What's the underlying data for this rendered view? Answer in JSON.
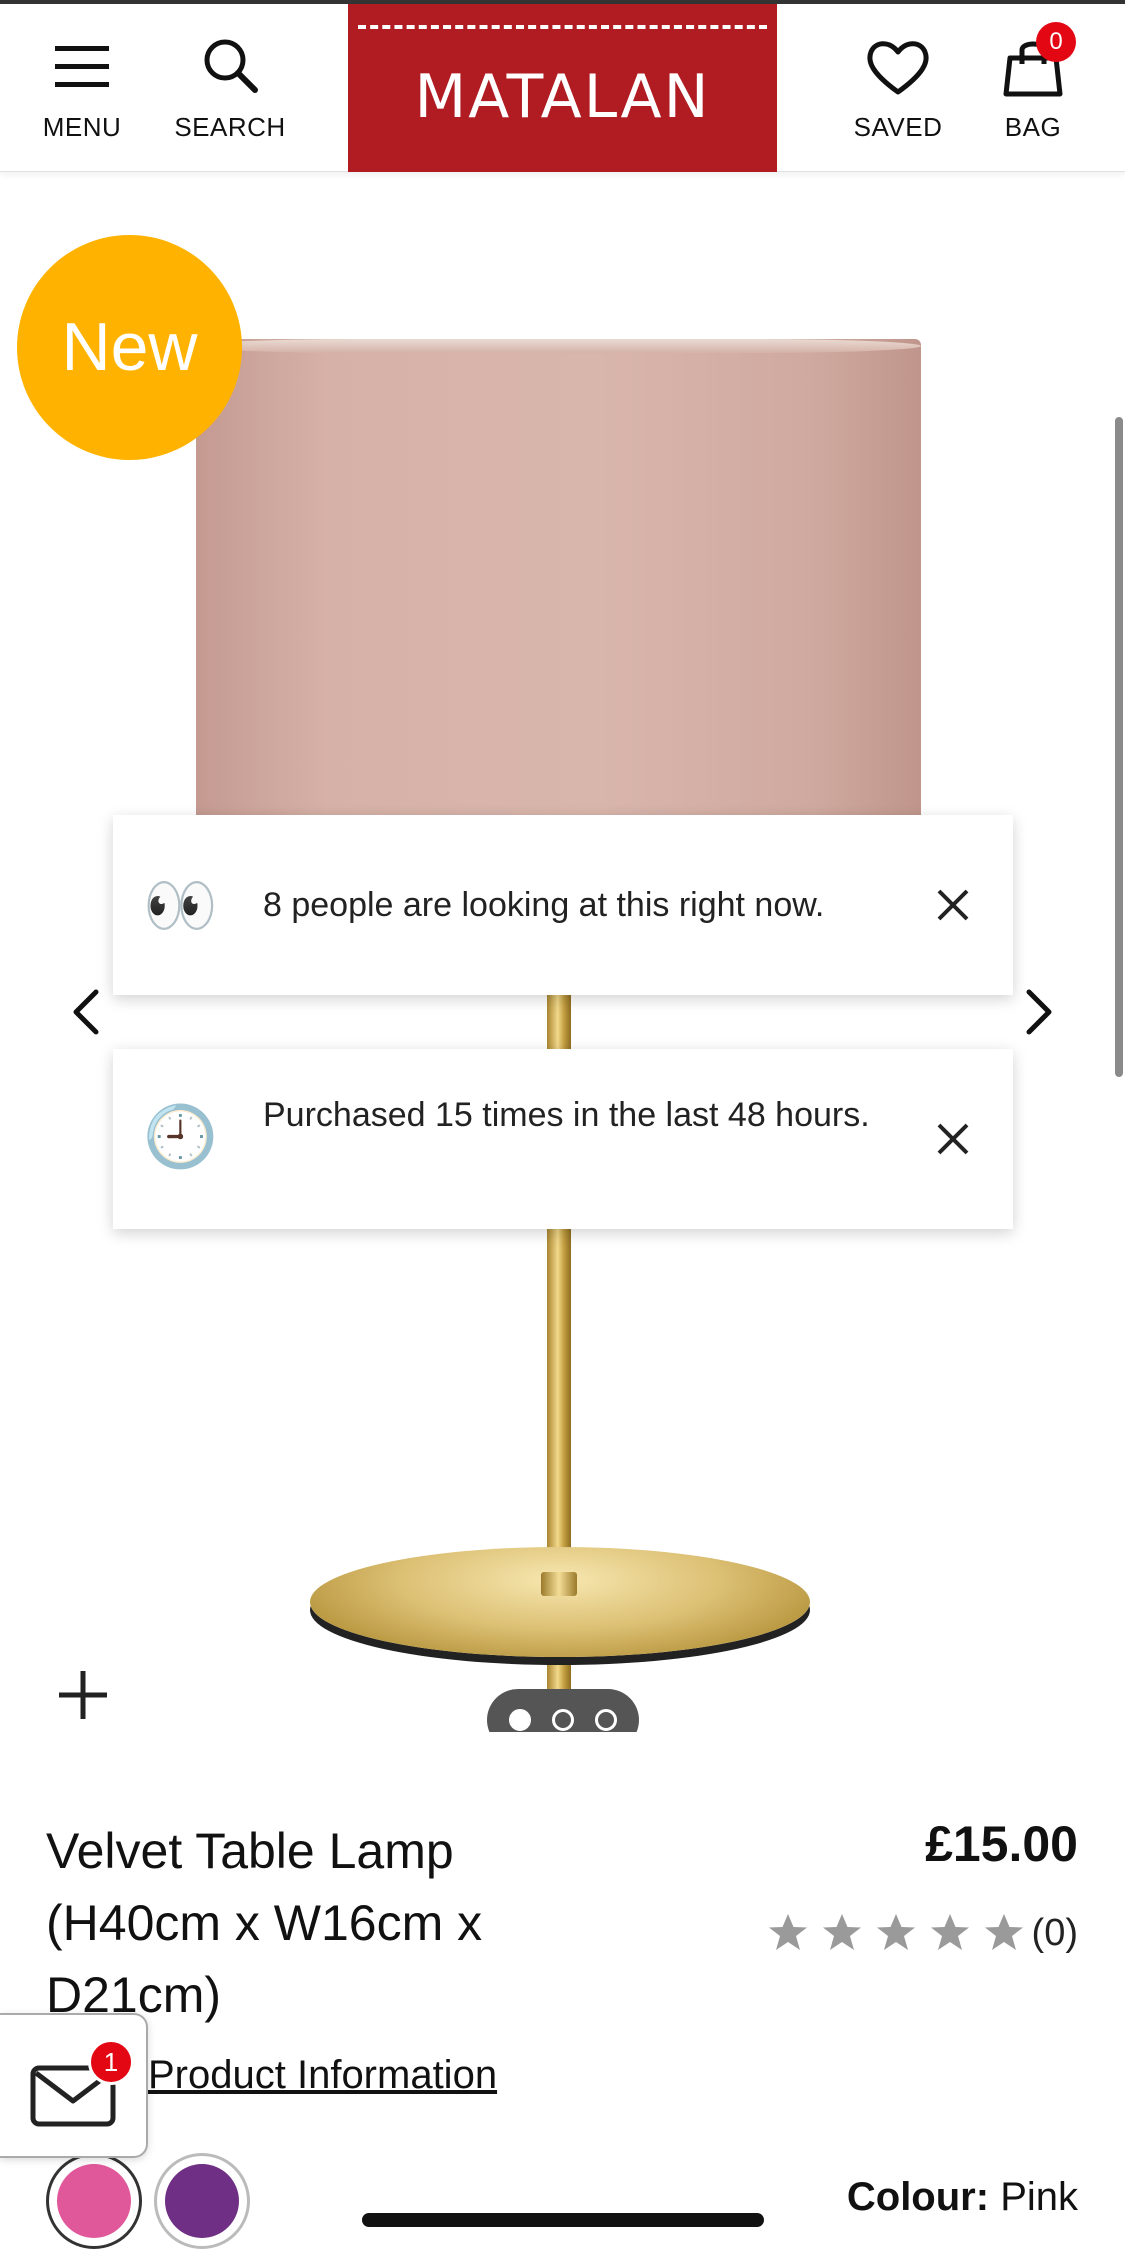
{
  "header": {
    "menu_label": "MENU",
    "search_label": "SEARCH",
    "logo_text": "MATALAN",
    "saved_label": "SAVED",
    "bag_label": "BAG",
    "bag_count": "0"
  },
  "gallery": {
    "new_badge": "New",
    "popups": [
      {
        "emoji": "👀",
        "message": "8 people are looking at this right now."
      },
      {
        "emoji": "🕘",
        "message": "Purchased 15 times in the last 48 hours."
      }
    ],
    "image_count": 3,
    "active_image": 1
  },
  "product": {
    "title": "Velvet Table Lamp (H40cm x W16cm x D21cm)",
    "price": "£15.00",
    "rating_stars": 0,
    "rating_count": "(0)",
    "info_link": "Product Information",
    "colour_label": "Colour:",
    "colour_value": "Pink",
    "swatches": [
      {
        "name": "Pink",
        "color": "#e0589a"
      },
      {
        "name": "Purple",
        "color": "#6e2f84"
      }
    ]
  },
  "mail_widget": {
    "badge_count": "1"
  },
  "colors": {
    "brand_red": "#b01c22",
    "badge_yellow": "#ffb300",
    "alert_red": "#e30613",
    "star_grey": "#9a9a9a"
  }
}
